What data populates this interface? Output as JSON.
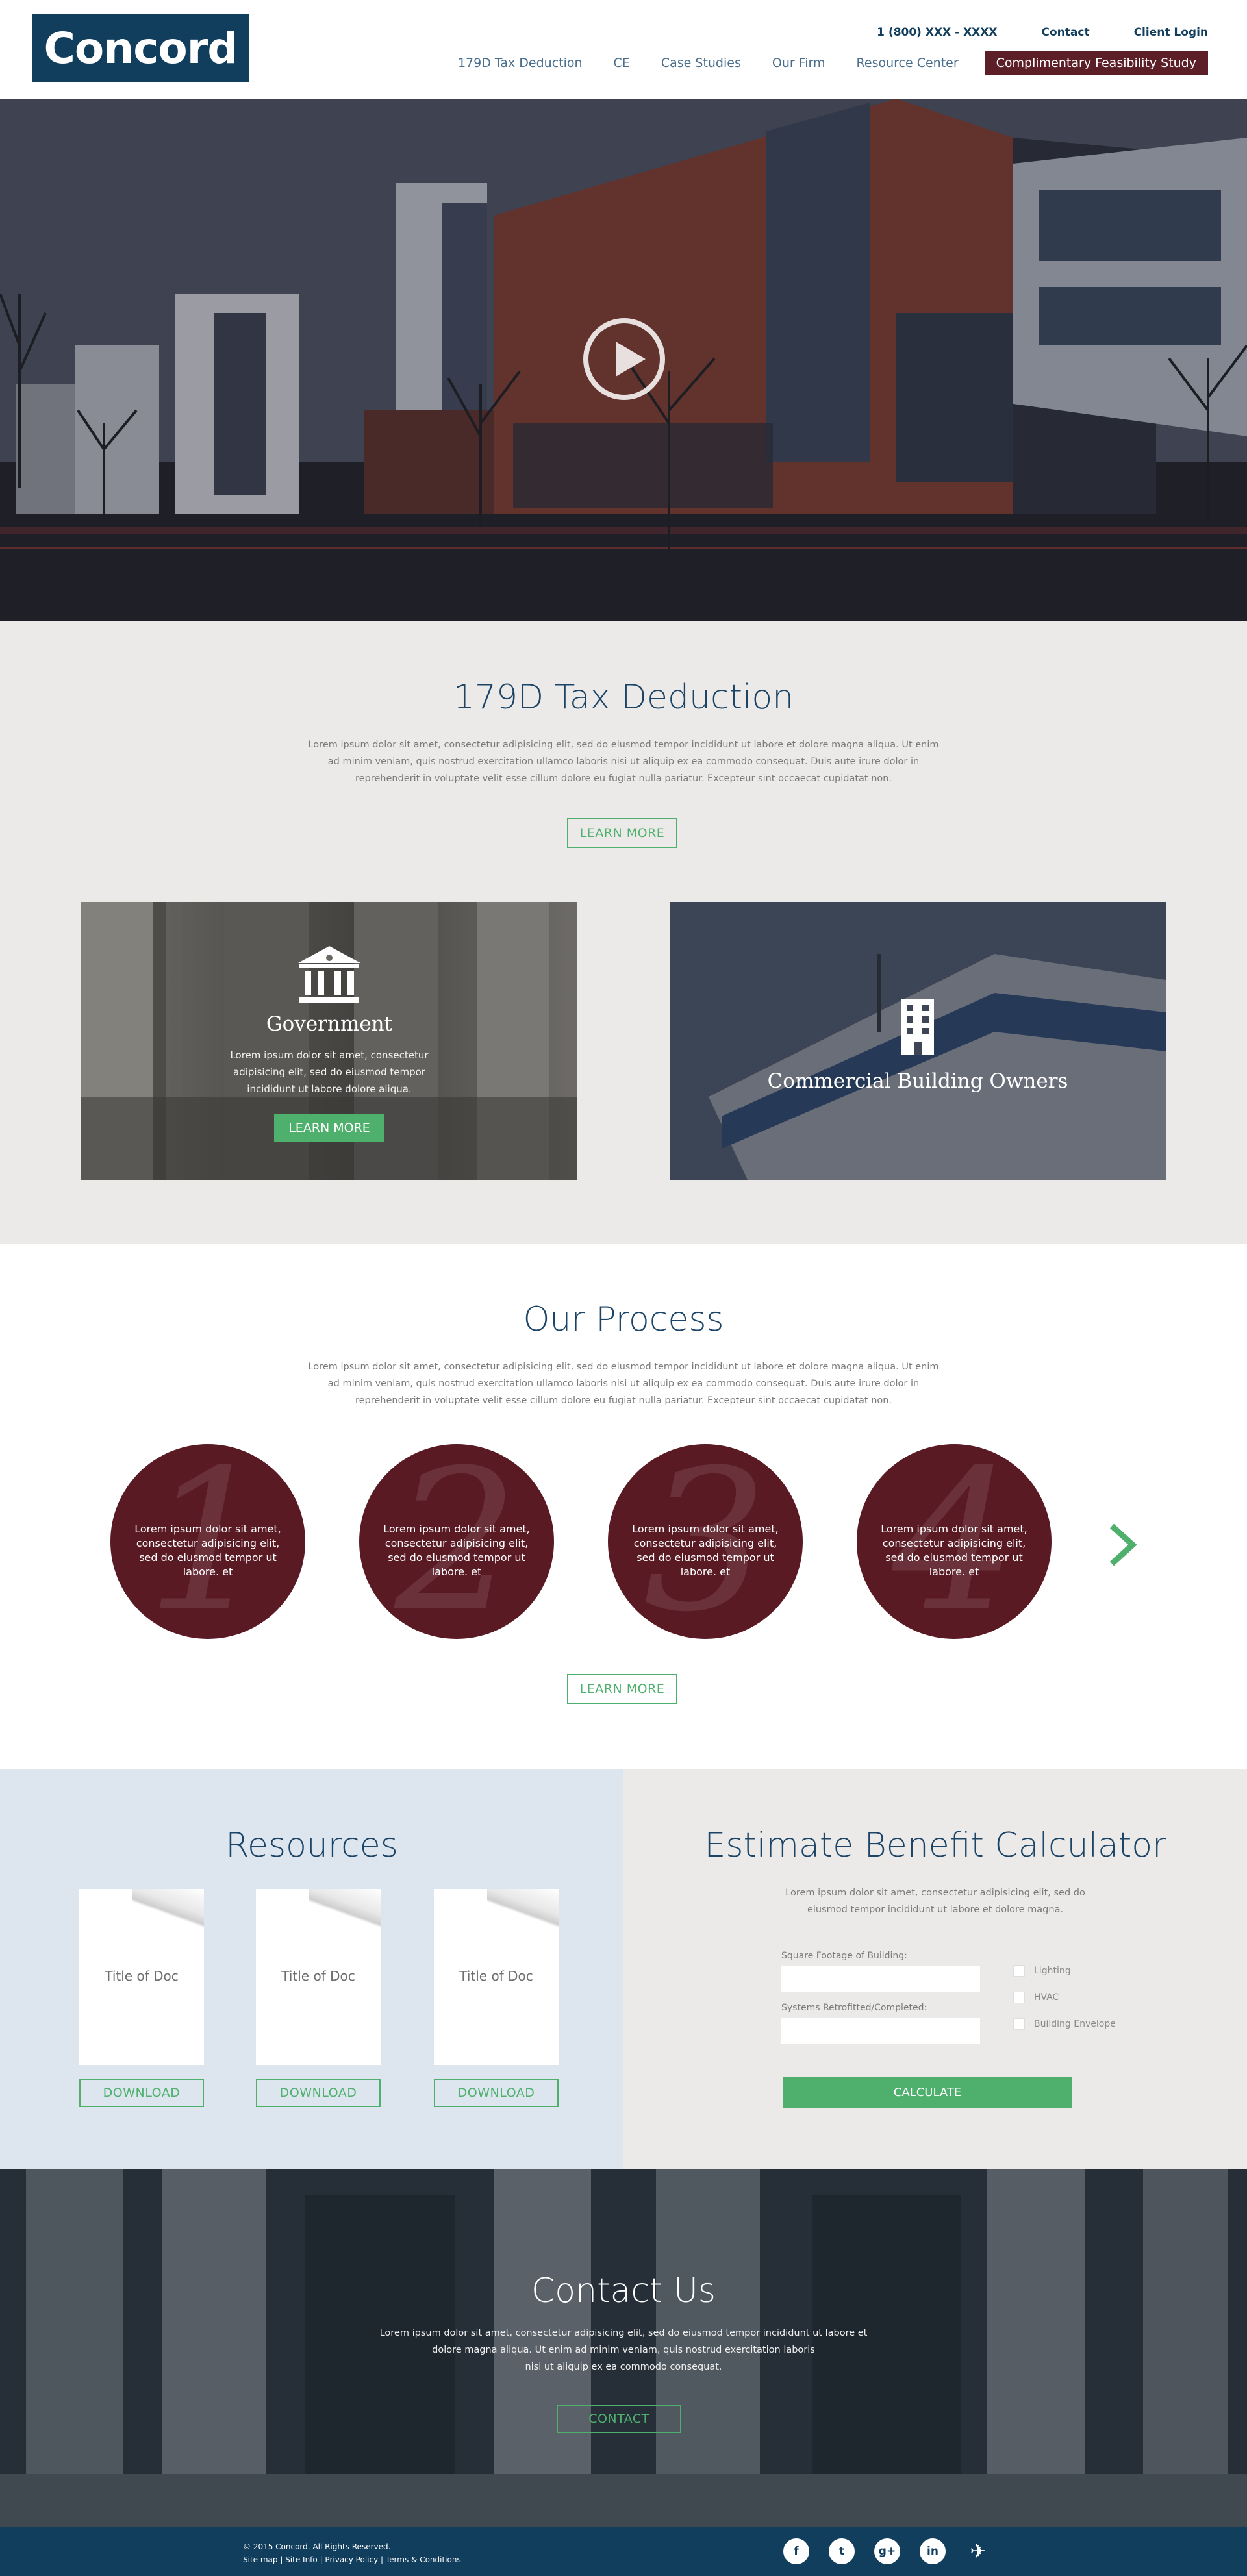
{
  "brand": {
    "logo_text": "Concord",
    "navy": "#123e5e",
    "maroon": "#5d1f27",
    "green": "#4fb06e"
  },
  "utility_nav": {
    "phone": "1 (800) XXX - XXXX",
    "contact": "Contact",
    "client_login": "Client Login"
  },
  "main_nav": [
    {
      "label": "179D Tax Deduction"
    },
    {
      "label": "CE"
    },
    {
      "label": "Case Studies"
    },
    {
      "label": "Our Firm"
    },
    {
      "label": "Resource Center"
    },
    {
      "label": "Complimentary Feasibility Study"
    }
  ],
  "hero": {
    "play_icon": "play-icon"
  },
  "tax_section": {
    "title": "179D Tax Deduction",
    "body_lines": [
      "Lorem ipsum dolor sit amet, consectetur adipisicing elit, sed do eiusmod tempor incididunt ut labore et dolore magna aliqua. Ut enim",
      "ad minim veniam, quis nostrud exercitation ullamco laboris nisi ut aliquip ex ea commodo consequat. Duis aute irure dolor in",
      "reprehenderit in voluptate velit esse cillum dolore eu fugiat nulla pariatur. Excepteur sint occaecat cupidatat non."
    ],
    "button": "LEARN MORE",
    "cards": [
      {
        "title": "Government",
        "icon": "bank-icon",
        "text_lines": [
          "Lorem ipsum dolor sit amet, consectetur",
          "adipisicing elit, sed do eiusmod tempor",
          "incididunt ut labore dolore aliqua."
        ],
        "button": "LEARN MORE"
      },
      {
        "title": "Commercial Building Owners",
        "icon": "building-icon"
      }
    ]
  },
  "process": {
    "title": "Our Process",
    "body_lines": [
      "Lorem ipsum dolor sit amet, consectetur adipisicing elit, sed do eiusmod tempor incididunt ut labore et dolore magna aliqua. Ut enim",
      "ad minim veniam, quis nostrud exercitation ullamco laboris nisi ut aliquip ex ea commodo consequat. Duis aute irure dolor in",
      "reprehenderit in voluptate velit esse cillum dolore eu fugiat nulla pariatur. Excepteur sint occaecat cupidatat non."
    ],
    "steps": [
      {
        "number": "1",
        "text": "Lorem ipsum dolor sit amet, consectetur adipisicing elit, sed do eiusmod tempor ut labore. et"
      },
      {
        "number": "2",
        "text": "Lorem ipsum dolor sit amet, consectetur adipisicing elit, sed do eiusmod tempor ut labore. et"
      },
      {
        "number": "3",
        "text": "Lorem ipsum dolor sit amet, consectetur adipisicing elit, sed do eiusmod tempor ut labore. et"
      },
      {
        "number": "4",
        "text": "Lorem ipsum dolor sit amet, consectetur adipisicing elit, sed do eiusmod tempor ut labore. et"
      }
    ],
    "next_icon": "chevron-right-icon",
    "button": "LEARN MORE"
  },
  "resources": {
    "title": "Resources",
    "docs": [
      {
        "title": "Title of Doc",
        "button": "DOWNLOAD"
      },
      {
        "title": "Title of Doc",
        "button": "DOWNLOAD"
      },
      {
        "title": "Title of Doc",
        "button": "DOWNLOAD"
      }
    ]
  },
  "calculator": {
    "title": "Estimate Benefit Calculator",
    "body_lines": [
      "Lorem ipsum dolor sit amet, consectetur adipisicing elit, sed do",
      "eiusmod tempor incididunt ut labore et dolore magna."
    ],
    "field1_label": "Square Footage of Building:",
    "field2_label": "Systems Retrofitted/Completed:",
    "checkboxes": [
      {
        "label": "Lighting"
      },
      {
        "label": "HVAC"
      },
      {
        "label": "Building Envelope"
      }
    ],
    "button": "CALCULATE"
  },
  "contact": {
    "title": "Contact Us",
    "body_lines": [
      "Lorem ipsum dolor sit amet, consectetur adipisicing elit, sed do eiusmod tempor incididunt ut labore et",
      "dolore magna aliqua. Ut enim ad minim veniam, quis nostrud exercitation laboris",
      "nisi ut aliquip ex ea commodo consequat."
    ],
    "button": "CONTACT"
  },
  "footer": {
    "copyright": "© 2015 Concord. All Rights Reserved.",
    "links": "Site map | Site Info | Privacy Policy | Terms & Conditions",
    "social": [
      {
        "icon": "facebook-icon",
        "glyph": "f"
      },
      {
        "icon": "twitter-icon",
        "glyph": "t"
      },
      {
        "icon": "google-plus-icon",
        "glyph": "g+"
      },
      {
        "icon": "linkedin-icon",
        "glyph": "in"
      },
      {
        "icon": "eagle-icon",
        "glyph": "✈"
      }
    ]
  }
}
